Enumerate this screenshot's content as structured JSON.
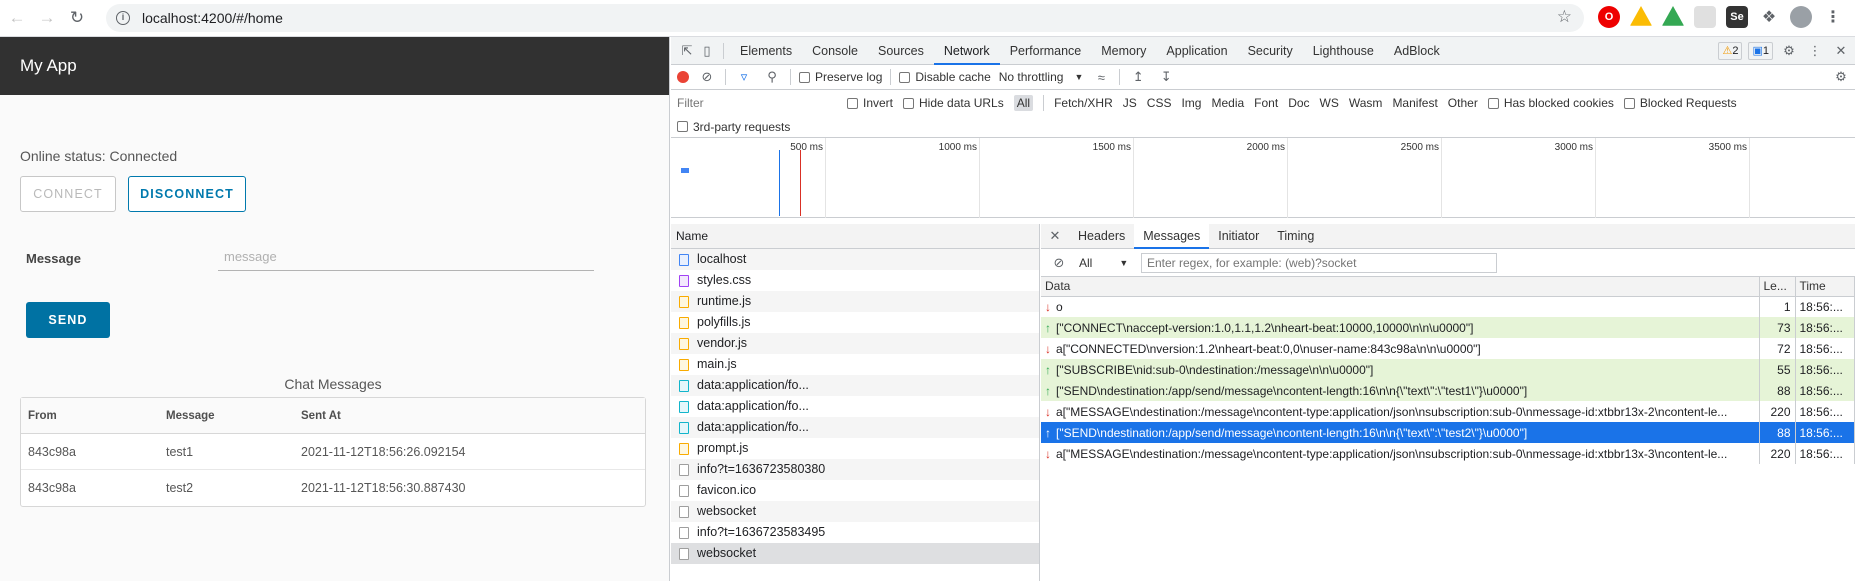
{
  "browser": {
    "url": "localhost:4200/#/home",
    "extensions": [
      "opera-icon",
      "drive-icon",
      "drive-icon",
      "screenshot-icon",
      "selenium-icon",
      "puzzle-icon",
      "profile-icon",
      "menu-icon"
    ]
  },
  "app": {
    "title": "My App",
    "status": "Online status: Connected",
    "connect_label": "CONNECT",
    "disconnect_label": "DISCONNECT",
    "message_label": "Message",
    "message_placeholder": "message",
    "send_label": "SEND",
    "chat_title": "Chat Messages",
    "chat_headers": [
      "From",
      "Message",
      "Sent At"
    ],
    "chat_rows": [
      [
        "843c98a",
        "test1",
        "2021-11-12T18:56:26.092154"
      ],
      [
        "843c98a",
        "test2",
        "2021-11-12T18:56:30.887430"
      ]
    ]
  },
  "devtools": {
    "tabs": [
      "Elements",
      "Console",
      "Sources",
      "Network",
      "Performance",
      "Memory",
      "Application",
      "Security",
      "Lighthouse",
      "AdBlock"
    ],
    "active_tab": "Network",
    "warnings": "2",
    "messages_count": "1",
    "toolbar": {
      "preserve_log": "Preserve log",
      "disable_cache": "Disable cache",
      "throttling": "No throttling"
    },
    "filter": {
      "placeholder": "Filter",
      "invert": "Invert",
      "hide_data_urls": "Hide data URLs",
      "types": [
        "All",
        "Fetch/XHR",
        "JS",
        "CSS",
        "Img",
        "Media",
        "Font",
        "Doc",
        "WS",
        "Wasm",
        "Manifest",
        "Other"
      ],
      "has_blocked_cookies": "Has blocked cookies",
      "blocked_requests": "Blocked Requests",
      "third_party": "3rd-party requests"
    },
    "timeline_ticks": [
      "500 ms",
      "1000 ms",
      "1500 ms",
      "2000 ms",
      "2500 ms",
      "3000 ms",
      "3500 ms"
    ],
    "list_header": "Name",
    "requests": [
      {
        "name": "localhost",
        "kind": "doc"
      },
      {
        "name": "styles.css",
        "kind": "css"
      },
      {
        "name": "runtime.js",
        "kind": "js"
      },
      {
        "name": "polyfills.js",
        "kind": "js"
      },
      {
        "name": "vendor.js",
        "kind": "js"
      },
      {
        "name": "main.js",
        "kind": "js"
      },
      {
        "name": "data:application/fo...",
        "kind": "font"
      },
      {
        "name": "data:application/fo...",
        "kind": "font"
      },
      {
        "name": "data:application/fo...",
        "kind": "font"
      },
      {
        "name": "prompt.js",
        "kind": "js"
      },
      {
        "name": "info?t=1636723580380",
        "kind": "other"
      },
      {
        "name": "favicon.ico",
        "kind": "other"
      },
      {
        "name": "websocket",
        "kind": "other"
      },
      {
        "name": "info?t=1636723583495",
        "kind": "other"
      },
      {
        "name": "websocket",
        "kind": "other"
      }
    ],
    "detail_tabs": [
      "Headers",
      "Messages",
      "Initiator",
      "Timing"
    ],
    "active_detail_tab": "Messages",
    "msg_filter": "All",
    "regex_placeholder": "Enter regex, for example: (web)?socket",
    "msg_headers": [
      "Data",
      "Le...",
      "Time"
    ],
    "messages": [
      {
        "dir": "down",
        "data": "o",
        "len": "1",
        "time": "18:56:..."
      },
      {
        "dir": "up",
        "data": "[\"CONNECT\\naccept-version:1.0,1.1,1.2\\nheart-beat:10000,10000\\n\\n\\u0000\"]",
        "len": "73",
        "time": "18:56:..."
      },
      {
        "dir": "down",
        "data": "a[\"CONNECTED\\nversion:1.2\\nheart-beat:0,0\\nuser-name:843c98a\\n\\n\\u0000\"]",
        "len": "72",
        "time": "18:56:..."
      },
      {
        "dir": "up",
        "data": "[\"SUBSCRIBE\\nid:sub-0\\ndestination:/message\\n\\n\\u0000\"]",
        "len": "55",
        "time": "18:56:..."
      },
      {
        "dir": "up",
        "data": "[\"SEND\\ndestination:/app/send/message\\ncontent-length:16\\n\\n{\\\"text\\\":\\\"test1\\\"}\\u0000\"]",
        "len": "88",
        "time": "18:56:..."
      },
      {
        "dir": "down",
        "data": "a[\"MESSAGE\\ndestination:/message\\ncontent-type:application/json\\nsubscription:sub-0\\nmessage-id:xtbbr13x-2\\ncontent-le...",
        "len": "220",
        "time": "18:56:..."
      },
      {
        "dir": "up",
        "data": "[\"SEND\\ndestination:/app/send/message\\ncontent-length:16\\n\\n{\\\"text\\\":\\\"test2\\\"}\\u0000\"]",
        "len": "88",
        "time": "18:56:..."
      },
      {
        "dir": "down",
        "data": "a[\"MESSAGE\\ndestination:/message\\ncontent-type:application/json\\nsubscription:sub-0\\nmessage-id:xtbbr13x-3\\ncontent-le...",
        "len": "220",
        "time": "18:56:..."
      }
    ]
  }
}
